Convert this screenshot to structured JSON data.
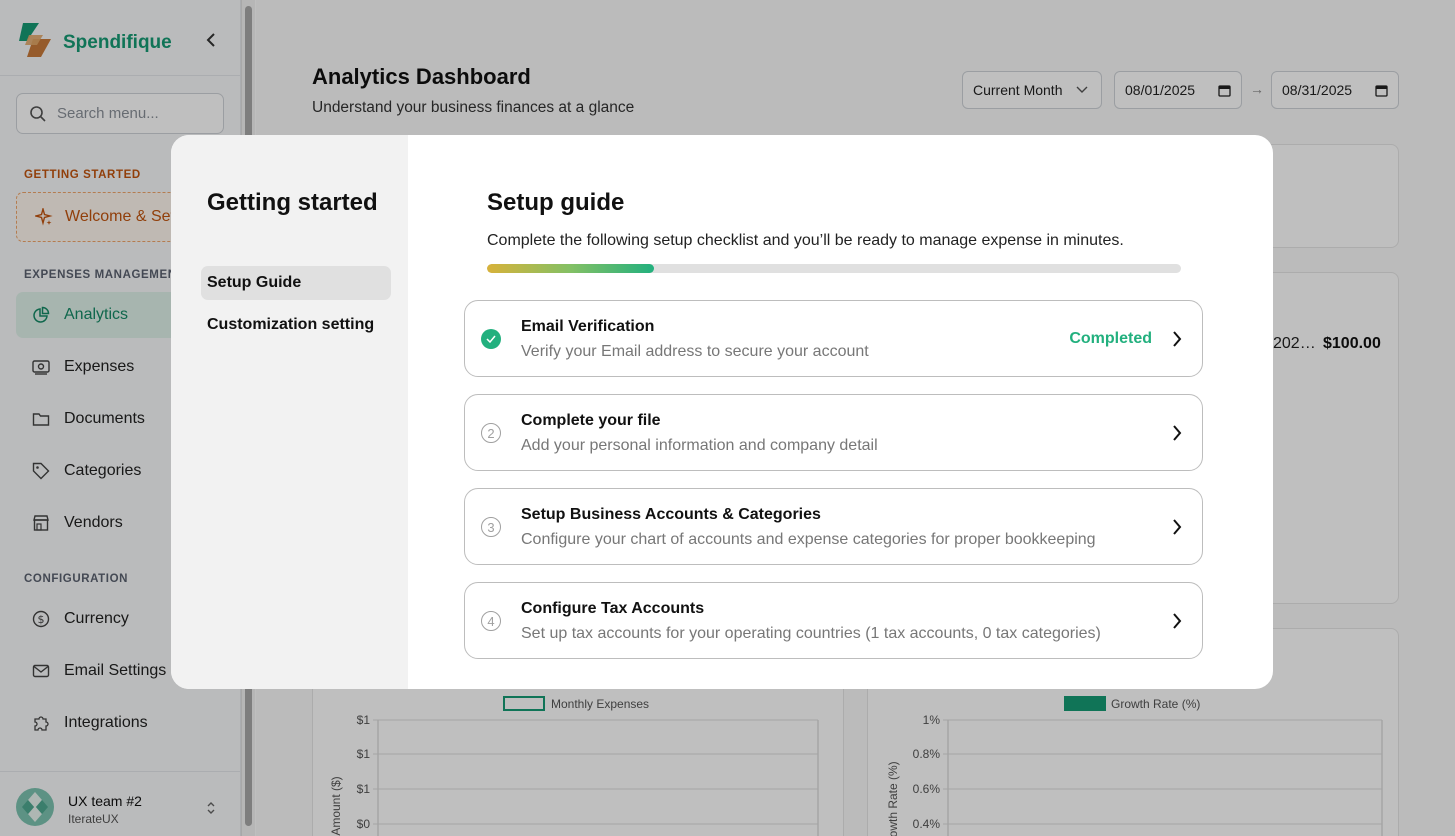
{
  "brand": {
    "name": "Spendifique",
    "color": "#169b74"
  },
  "search": {
    "placeholder": "Search menu..."
  },
  "sidebar": {
    "sections": [
      {
        "label": "GETTING STARTED"
      },
      {
        "label": "EXPENSES MANAGEMENT"
      },
      {
        "label": "CONFIGURATION"
      }
    ],
    "welcome_label": "Welcome & Setup",
    "items": [
      {
        "label": "Analytics",
        "icon": "analytics-icon",
        "active": true
      },
      {
        "label": "Expenses",
        "icon": "cash-icon"
      },
      {
        "label": "Documents",
        "icon": "folder-icon"
      },
      {
        "label": "Categories",
        "icon": "tag-icon"
      },
      {
        "label": "Vendors",
        "icon": "store-icon"
      },
      {
        "label": "Currency",
        "icon": "dollar-icon"
      },
      {
        "label": "Email Settings",
        "icon": "mail-icon"
      },
      {
        "label": "Integrations",
        "icon": "puzzle-icon"
      }
    ],
    "team": {
      "name": "UX team #2",
      "org": "IterateUX"
    }
  },
  "dashboard": {
    "title": "Analytics Dashboard",
    "subtitle": "Understand your business finances at a glance",
    "period_select": "Current Month",
    "date_from": "08/01/2025",
    "date_to": "08/31/2025",
    "recent_row": {
      "date": "202…",
      "amount": "$100.00"
    }
  },
  "chart_data": [
    {
      "type": "bar",
      "legend": [
        "Monthly Expenses"
      ],
      "ylabel": "Amount ($)",
      "y_ticks": [
        "$1",
        "$1",
        "$1",
        "$0"
      ],
      "series": [
        {
          "name": "Monthly Expenses",
          "values": []
        }
      ]
    },
    {
      "type": "bar",
      "legend": [
        "Growth Rate (%)"
      ],
      "ylabel": "Growth Rate (%)",
      "y_ticks": [
        "1%",
        "0.8%",
        "0.6%",
        "0.4%"
      ],
      "series": [
        {
          "name": "Growth Rate (%)",
          "values": []
        }
      ]
    }
  ],
  "modal": {
    "heading": "Getting started",
    "tabs": [
      {
        "label": "Setup Guide"
      },
      {
        "label": "Customization setting"
      }
    ],
    "guide_title": "Setup guide",
    "guide_desc": "Complete the following setup checklist and you’ll be ready to manage expense in minutes.",
    "progress": 0.24,
    "steps": [
      {
        "num": "1",
        "title": "Email Verification",
        "desc": "Verify your Email address to secure your account",
        "status": "Completed",
        "done": true
      },
      {
        "num": "2",
        "title": "Complete your file",
        "desc": "Add your personal information and company detail",
        "status": "",
        "done": false
      },
      {
        "num": "3",
        "title": "Setup Business Accounts & Categories",
        "desc": "Configure your chart of accounts and expense categories for proper bookkeeping",
        "status": "",
        "done": false
      },
      {
        "num": "4",
        "title": "Configure Tax Accounts",
        "desc": "Set up tax accounts for your operating countries (1 tax accounts, 0 tax categories)",
        "status": "",
        "done": false
      }
    ]
  }
}
